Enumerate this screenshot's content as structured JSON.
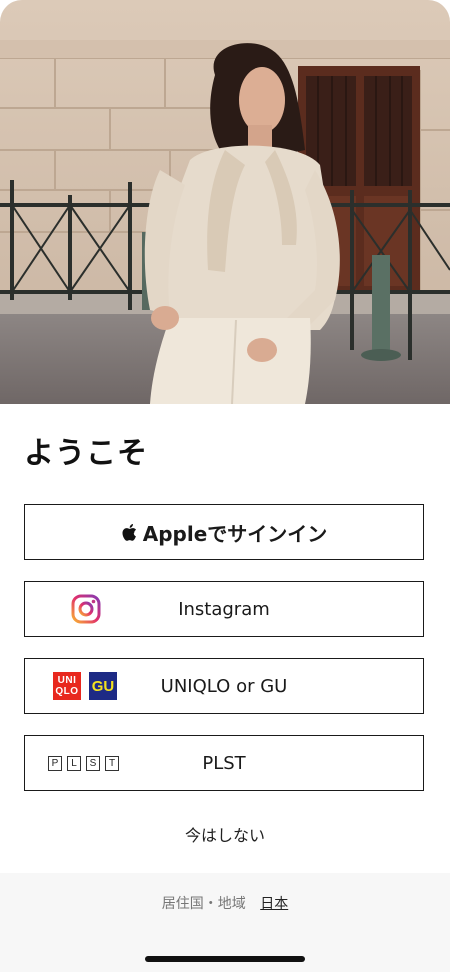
{
  "hero": {
    "image": "woman-in-beige-knit-outfit-photo"
  },
  "welcome_title": "ようこそ",
  "buttons": {
    "apple": {
      "label": "Appleでサインイン",
      "icon": "apple-icon"
    },
    "instagram": {
      "label": "Instagram",
      "icon": "instagram-icon"
    },
    "uniqlo_gu": {
      "label": "UNIQLO or GU",
      "logo_uniqlo": [
        "UNI",
        "QLO"
      ],
      "logo_gu": "GU"
    },
    "plst": {
      "label": "PLST",
      "logo_letters": [
        "P",
        "L",
        "S",
        "T"
      ]
    }
  },
  "skip_label": "今はしない",
  "footer": {
    "region_label": "居住国・地域",
    "region_value": "日本"
  },
  "colors": {
    "uniqlo_red": "#e8281e",
    "gu_blue": "#1d2a85",
    "gu_yellow": "#f2e01f"
  }
}
